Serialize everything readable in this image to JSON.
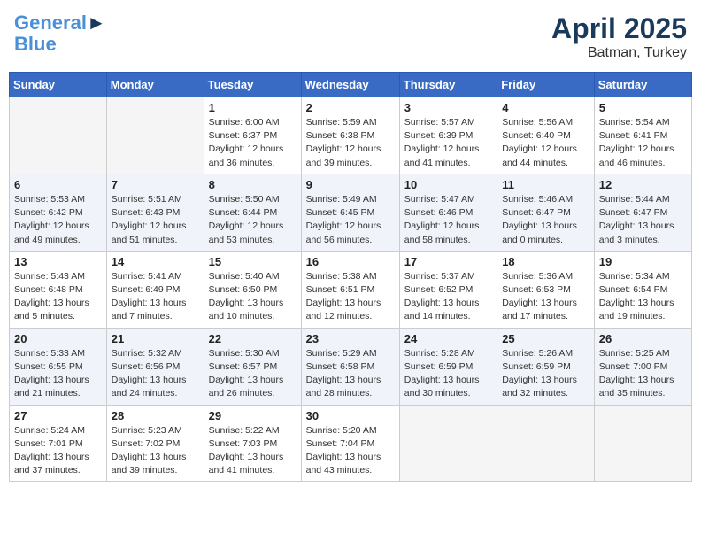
{
  "header": {
    "logo_line1": "General",
    "logo_line2": "Blue",
    "month": "April 2025",
    "location": "Batman, Turkey"
  },
  "weekdays": [
    "Sunday",
    "Monday",
    "Tuesday",
    "Wednesday",
    "Thursday",
    "Friday",
    "Saturday"
  ],
  "weeks": [
    [
      {
        "day": "",
        "info": []
      },
      {
        "day": "",
        "info": []
      },
      {
        "day": "1",
        "info": [
          "Sunrise: 6:00 AM",
          "Sunset: 6:37 PM",
          "Daylight: 12 hours",
          "and 36 minutes."
        ]
      },
      {
        "day": "2",
        "info": [
          "Sunrise: 5:59 AM",
          "Sunset: 6:38 PM",
          "Daylight: 12 hours",
          "and 39 minutes."
        ]
      },
      {
        "day": "3",
        "info": [
          "Sunrise: 5:57 AM",
          "Sunset: 6:39 PM",
          "Daylight: 12 hours",
          "and 41 minutes."
        ]
      },
      {
        "day": "4",
        "info": [
          "Sunrise: 5:56 AM",
          "Sunset: 6:40 PM",
          "Daylight: 12 hours",
          "and 44 minutes."
        ]
      },
      {
        "day": "5",
        "info": [
          "Sunrise: 5:54 AM",
          "Sunset: 6:41 PM",
          "Daylight: 12 hours",
          "and 46 minutes."
        ]
      }
    ],
    [
      {
        "day": "6",
        "info": [
          "Sunrise: 5:53 AM",
          "Sunset: 6:42 PM",
          "Daylight: 12 hours",
          "and 49 minutes."
        ]
      },
      {
        "day": "7",
        "info": [
          "Sunrise: 5:51 AM",
          "Sunset: 6:43 PM",
          "Daylight: 12 hours",
          "and 51 minutes."
        ]
      },
      {
        "day": "8",
        "info": [
          "Sunrise: 5:50 AM",
          "Sunset: 6:44 PM",
          "Daylight: 12 hours",
          "and 53 minutes."
        ]
      },
      {
        "day": "9",
        "info": [
          "Sunrise: 5:49 AM",
          "Sunset: 6:45 PM",
          "Daylight: 12 hours",
          "and 56 minutes."
        ]
      },
      {
        "day": "10",
        "info": [
          "Sunrise: 5:47 AM",
          "Sunset: 6:46 PM",
          "Daylight: 12 hours",
          "and 58 minutes."
        ]
      },
      {
        "day": "11",
        "info": [
          "Sunrise: 5:46 AM",
          "Sunset: 6:47 PM",
          "Daylight: 13 hours",
          "and 0 minutes."
        ]
      },
      {
        "day": "12",
        "info": [
          "Sunrise: 5:44 AM",
          "Sunset: 6:47 PM",
          "Daylight: 13 hours",
          "and 3 minutes."
        ]
      }
    ],
    [
      {
        "day": "13",
        "info": [
          "Sunrise: 5:43 AM",
          "Sunset: 6:48 PM",
          "Daylight: 13 hours",
          "and 5 minutes."
        ]
      },
      {
        "day": "14",
        "info": [
          "Sunrise: 5:41 AM",
          "Sunset: 6:49 PM",
          "Daylight: 13 hours",
          "and 7 minutes."
        ]
      },
      {
        "day": "15",
        "info": [
          "Sunrise: 5:40 AM",
          "Sunset: 6:50 PM",
          "Daylight: 13 hours",
          "and 10 minutes."
        ]
      },
      {
        "day": "16",
        "info": [
          "Sunrise: 5:38 AM",
          "Sunset: 6:51 PM",
          "Daylight: 13 hours",
          "and 12 minutes."
        ]
      },
      {
        "day": "17",
        "info": [
          "Sunrise: 5:37 AM",
          "Sunset: 6:52 PM",
          "Daylight: 13 hours",
          "and 14 minutes."
        ]
      },
      {
        "day": "18",
        "info": [
          "Sunrise: 5:36 AM",
          "Sunset: 6:53 PM",
          "Daylight: 13 hours",
          "and 17 minutes."
        ]
      },
      {
        "day": "19",
        "info": [
          "Sunrise: 5:34 AM",
          "Sunset: 6:54 PM",
          "Daylight: 13 hours",
          "and 19 minutes."
        ]
      }
    ],
    [
      {
        "day": "20",
        "info": [
          "Sunrise: 5:33 AM",
          "Sunset: 6:55 PM",
          "Daylight: 13 hours",
          "and 21 minutes."
        ]
      },
      {
        "day": "21",
        "info": [
          "Sunrise: 5:32 AM",
          "Sunset: 6:56 PM",
          "Daylight: 13 hours",
          "and 24 minutes."
        ]
      },
      {
        "day": "22",
        "info": [
          "Sunrise: 5:30 AM",
          "Sunset: 6:57 PM",
          "Daylight: 13 hours",
          "and 26 minutes."
        ]
      },
      {
        "day": "23",
        "info": [
          "Sunrise: 5:29 AM",
          "Sunset: 6:58 PM",
          "Daylight: 13 hours",
          "and 28 minutes."
        ]
      },
      {
        "day": "24",
        "info": [
          "Sunrise: 5:28 AM",
          "Sunset: 6:59 PM",
          "Daylight: 13 hours",
          "and 30 minutes."
        ]
      },
      {
        "day": "25",
        "info": [
          "Sunrise: 5:26 AM",
          "Sunset: 6:59 PM",
          "Daylight: 13 hours",
          "and 32 minutes."
        ]
      },
      {
        "day": "26",
        "info": [
          "Sunrise: 5:25 AM",
          "Sunset: 7:00 PM",
          "Daylight: 13 hours",
          "and 35 minutes."
        ]
      }
    ],
    [
      {
        "day": "27",
        "info": [
          "Sunrise: 5:24 AM",
          "Sunset: 7:01 PM",
          "Daylight: 13 hours",
          "and 37 minutes."
        ]
      },
      {
        "day": "28",
        "info": [
          "Sunrise: 5:23 AM",
          "Sunset: 7:02 PM",
          "Daylight: 13 hours",
          "and 39 minutes."
        ]
      },
      {
        "day": "29",
        "info": [
          "Sunrise: 5:22 AM",
          "Sunset: 7:03 PM",
          "Daylight: 13 hours",
          "and 41 minutes."
        ]
      },
      {
        "day": "30",
        "info": [
          "Sunrise: 5:20 AM",
          "Sunset: 7:04 PM",
          "Daylight: 13 hours",
          "and 43 minutes."
        ]
      },
      {
        "day": "",
        "info": []
      },
      {
        "day": "",
        "info": []
      },
      {
        "day": "",
        "info": []
      }
    ]
  ]
}
